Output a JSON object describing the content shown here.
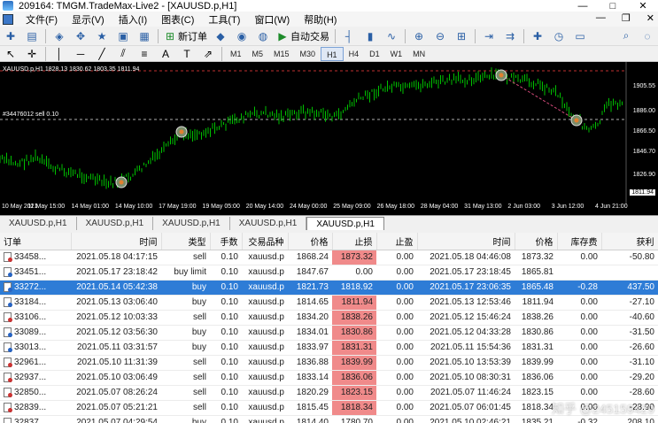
{
  "window": {
    "title": "209164: TMGM.TradeMax-Live2 - [XAUUSD.p,H1]",
    "min": "—",
    "max": "□",
    "close": "✕"
  },
  "menu": {
    "items": [
      "文件(F)",
      "显示(V)",
      "插入(I)",
      "图表(C)",
      "工具(T)",
      "窗口(W)",
      "帮助(H)"
    ],
    "right_min": "—",
    "right_restore": "❐",
    "right_close": "✕"
  },
  "toolbar": {
    "new_order_label": "新订单",
    "auto_trade_label": "自动交易"
  },
  "timeframes": [
    "M1",
    "M5",
    "M15",
    "M30",
    "H1",
    "H4",
    "D1",
    "W1",
    "MN"
  ],
  "active_timeframe": "H1",
  "chart": {
    "info": "XAUUSD.p,H1  1828.13 1830.62 1803.35 1811.94",
    "order_label": "#34476012 sell 0.10",
    "price_ticks": [
      "1905.55",
      "1886.00",
      "1866.50",
      "1846.70",
      "1826.90"
    ],
    "current_price": "1811.94",
    "time_ticks": [
      "10 May 2021",
      "11 May 15:00",
      "14 May 01:00",
      "14 May 10:00",
      "17 May 19:00",
      "19 May 05:00",
      "20 May 14:00",
      "24 May 00:00",
      "25 May 09:00",
      "26 May 18:00",
      "28 May 04:00",
      "31 May 13:00",
      "2 Jun 03:00",
      "3 Jun 12:00",
      "4 Jun 21:00"
    ],
    "colors": {
      "background": "#000000",
      "candle": "#00c000",
      "order_line": "#d44a7a"
    }
  },
  "tabs": [
    "XAUUSD.p,H1",
    "XAUUSD.p,H1",
    "XAUUSD.p,H1",
    "XAUUSD.p,H1",
    "XAUUSD.p,H1"
  ],
  "active_tab": 4,
  "table": {
    "headers": [
      "订单",
      "时间",
      "类型",
      "手数",
      "交易品种",
      "价格",
      "止损",
      "止盈",
      "时间",
      "价格",
      "库存费",
      "获利"
    ],
    "rows": [
      {
        "order": "33458...",
        "open_time": "2021.05.18 04:17:15",
        "type": "sell",
        "lots": "0.10",
        "symbol": "xauusd.p",
        "price": "1868.24",
        "sl": "1873.32",
        "tp": "0.00",
        "close_time": "2021.05.18 04:46:08",
        "close_price": "1873.32",
        "swap": "0.00",
        "profit": "-50.80",
        "sl_hit": true,
        "selected": false
      },
      {
        "order": "33451...",
        "open_time": "2021.05.17 23:18:42",
        "type": "buy limit",
        "lots": "0.10",
        "symbol": "xauusd.p",
        "price": "1847.67",
        "sl": "0.00",
        "tp": "0.00",
        "close_time": "2021.05.17 23:18:45",
        "close_price": "1865.81",
        "swap": "",
        "profit": "",
        "sl_hit": false,
        "selected": false
      },
      {
        "order": "33272...",
        "open_time": "2021.05.14 05:42:38",
        "type": "buy",
        "lots": "0.10",
        "symbol": "xauusd.p",
        "price": "1821.73",
        "sl": "1818.92",
        "tp": "0.00",
        "close_time": "2021.05.17 23:06:35",
        "close_price": "1865.48",
        "swap": "-0.28",
        "profit": "437.50",
        "sl_hit": false,
        "selected": true
      },
      {
        "order": "33184...",
        "open_time": "2021.05.13 03:06:40",
        "type": "buy",
        "lots": "0.10",
        "symbol": "xauusd.p",
        "price": "1814.65",
        "sl": "1811.94",
        "tp": "0.00",
        "close_time": "2021.05.13 12:53:46",
        "close_price": "1811.94",
        "swap": "0.00",
        "profit": "-27.10",
        "sl_hit": true,
        "selected": false
      },
      {
        "order": "33106...",
        "open_time": "2021.05.12 10:03:33",
        "type": "sell",
        "lots": "0.10",
        "symbol": "xauusd.p",
        "price": "1834.20",
        "sl": "1838.26",
        "tp": "0.00",
        "close_time": "2021.05.12 15:46:24",
        "close_price": "1838.26",
        "swap": "0.00",
        "profit": "-40.60",
        "sl_hit": true,
        "selected": false
      },
      {
        "order": "33089...",
        "open_time": "2021.05.12 03:56:30",
        "type": "buy",
        "lots": "0.10",
        "symbol": "xauusd.p",
        "price": "1834.01",
        "sl": "1830.86",
        "tp": "0.00",
        "close_time": "2021.05.12 04:33:28",
        "close_price": "1830.86",
        "swap": "0.00",
        "profit": "-31.50",
        "sl_hit": true,
        "selected": false
      },
      {
        "order": "33013...",
        "open_time": "2021.05.11 03:31:57",
        "type": "buy",
        "lots": "0.10",
        "symbol": "xauusd.p",
        "price": "1833.97",
        "sl": "1831.31",
        "tp": "0.00",
        "close_time": "2021.05.11 15:54:36",
        "close_price": "1831.31",
        "swap": "0.00",
        "profit": "-26.60",
        "sl_hit": true,
        "selected": false
      },
      {
        "order": "32961...",
        "open_time": "2021.05.10 11:31:39",
        "type": "sell",
        "lots": "0.10",
        "symbol": "xauusd.p",
        "price": "1836.88",
        "sl": "1839.99",
        "tp": "0.00",
        "close_time": "2021.05.10 13:53:39",
        "close_price": "1839.99",
        "swap": "0.00",
        "profit": "-31.10",
        "sl_hit": true,
        "selected": false
      },
      {
        "order": "32937...",
        "open_time": "2021.05.10 03:06:49",
        "type": "sell",
        "lots": "0.10",
        "symbol": "xauusd.p",
        "price": "1833.14",
        "sl": "1836.06",
        "tp": "0.00",
        "close_time": "2021.05.10 08:30:31",
        "close_price": "1836.06",
        "swap": "0.00",
        "profit": "-29.20",
        "sl_hit": true,
        "selected": false
      },
      {
        "order": "32850...",
        "open_time": "2021.05.07 08:26:24",
        "type": "sell",
        "lots": "0.10",
        "symbol": "xauusd.p",
        "price": "1820.29",
        "sl": "1823.15",
        "tp": "0.00",
        "close_time": "2021.05.07 11:46:24",
        "close_price": "1823.15",
        "swap": "0.00",
        "profit": "-28.60",
        "sl_hit": true,
        "selected": false
      },
      {
        "order": "32839...",
        "open_time": "2021.05.07 05:21:21",
        "type": "sell",
        "lots": "0.10",
        "symbol": "xauusd.p",
        "price": "1815.45",
        "sl": "1818.34",
        "tp": "0.00",
        "close_time": "2021.05.07 06:01:45",
        "close_price": "1818.34",
        "swap": "0.00",
        "profit": "-28.90",
        "sl_hit": true,
        "selected": false
      },
      {
        "order": "32837...",
        "open_time": "2021.05.07 04:29:54",
        "type": "buy",
        "lots": "0.10",
        "symbol": "xauusd.p",
        "price": "1814.40",
        "sl": "1780.70",
        "tp": "0.00",
        "close_time": "2021.05.10 02:46:21",
        "close_price": "1835.21",
        "swap": "-0.32",
        "profit": "208.10",
        "sl_hit": false,
        "selected": false
      }
    ]
  },
  "watermark": "知乎 @245159429"
}
